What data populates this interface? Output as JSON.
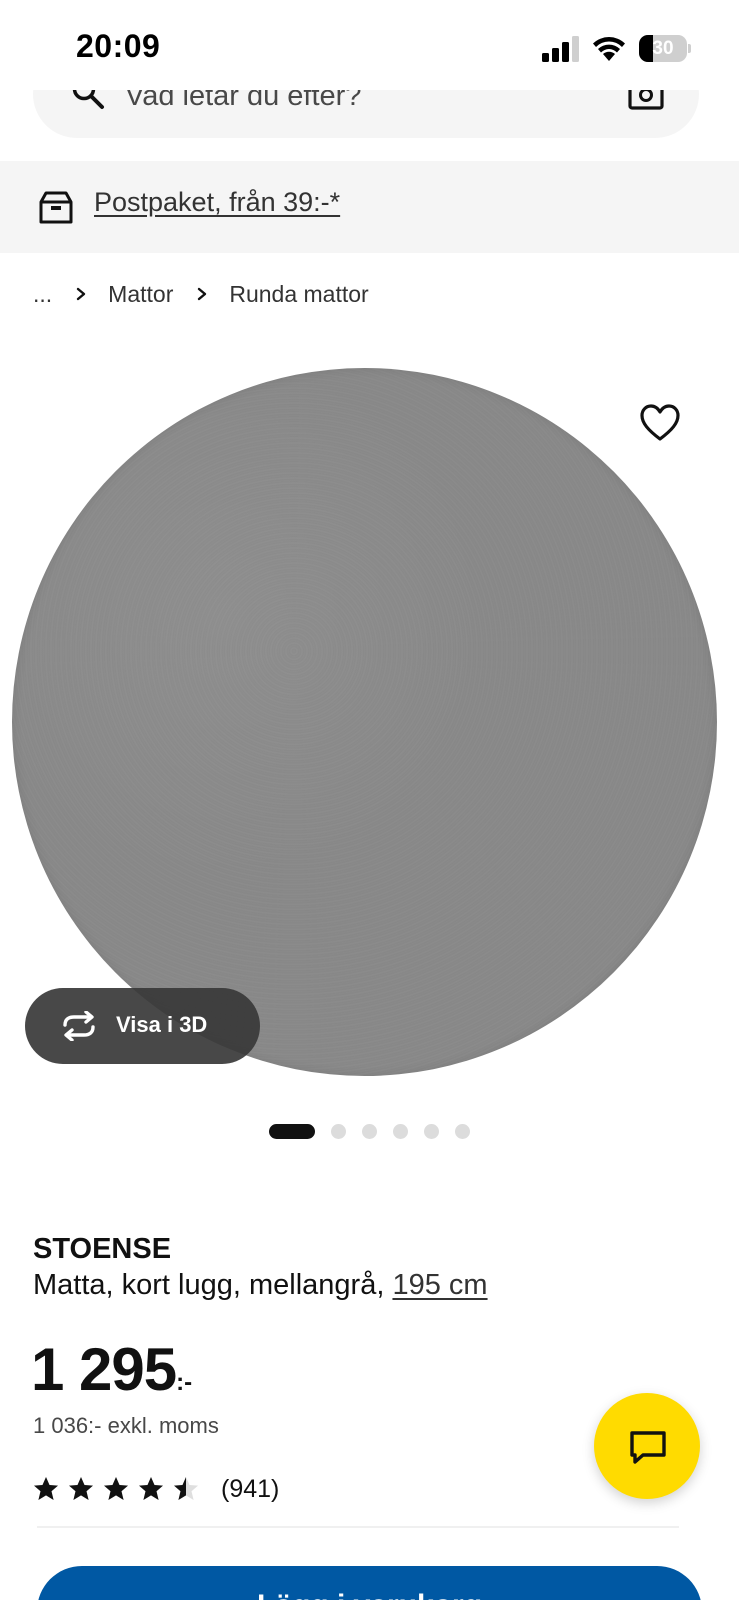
{
  "status_bar": {
    "time": "20:09",
    "battery_level": "30",
    "battery_fraction": 0.3,
    "icons": [
      "signal-icon",
      "wifi-icon",
      "battery-icon"
    ]
  },
  "search": {
    "placeholder": "Vad letar du efter?",
    "icons": [
      "search-icon",
      "camera-icon"
    ]
  },
  "banner": {
    "text": "Postpaket, från 39:-*",
    "icon": "delivery-box-icon"
  },
  "breadcrumb": {
    "ellipsis": "...",
    "items": [
      "Mattor",
      "Runda mattor"
    ]
  },
  "gallery": {
    "view_3d_label": "Visa i 3D",
    "image_count": 6,
    "active_index": 0,
    "favorite_icon": "heart-outline-icon"
  },
  "product": {
    "name": "STOENSE",
    "description": "Matta, kort lugg, mellangrå, ",
    "size": "195 cm",
    "price": "1 295",
    "price_suffix": ":-",
    "price_ex_vat": "1 036:- exkl. moms",
    "rating_value": 4.5,
    "rating_max": 5,
    "rating_count": "(941)"
  },
  "cta": {
    "label": "Lägg i varukorg"
  },
  "colors": {
    "accent_blue": "#0058a3",
    "chat_yellow": "#ffdb00",
    "surface_gray": "#f5f5f5",
    "rug_gray": "#888888"
  }
}
